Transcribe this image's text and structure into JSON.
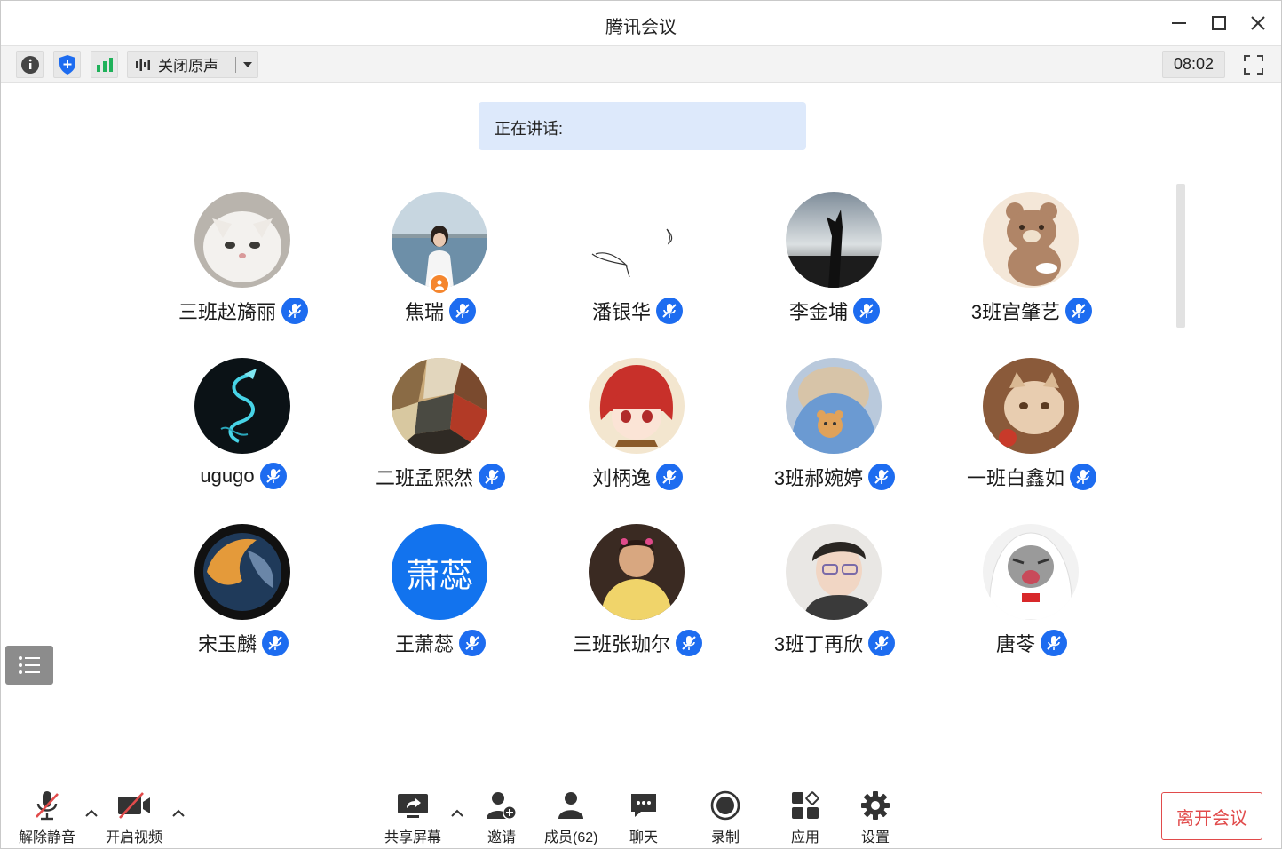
{
  "window": {
    "title": "腾讯会议"
  },
  "toolbar": {
    "info_icon": "info-icon",
    "shield_icon": "security-shield-icon",
    "signal_icon": "network-signal-icon",
    "audio_label": "关闭原声",
    "timer": "08:02"
  },
  "speaking": {
    "label": "正在讲话:"
  },
  "participants": [
    {
      "name": "三班赵旖丽",
      "avatar": "white-cat-photo"
    },
    {
      "name": "焦瑞",
      "avatar": "girl-by-sea-photo",
      "host": true
    },
    {
      "name": "潘银华",
      "avatar": "line-sketch"
    },
    {
      "name": "李金埔",
      "avatar": "sunset-hand-photo"
    },
    {
      "name": "3班宫肇艺",
      "avatar": "cartoon-bear"
    },
    {
      "name": "ugugo",
      "avatar": "neon-dragon"
    },
    {
      "name": "二班孟熙然",
      "avatar": "cubist-painting"
    },
    {
      "name": "刘柄逸",
      "avatar": "anime-red-hair"
    },
    {
      "name": "3班郝婉婷",
      "avatar": "blue-hoodie-bear"
    },
    {
      "name": "一班白鑫如",
      "avatar": "orange-cat-photo"
    },
    {
      "name": "宋玉麟",
      "avatar": "fisheye-planet"
    },
    {
      "name": "王萧蕊",
      "avatar": "text-avatar",
      "avatar_text": "萧蕊"
    },
    {
      "name": "三班张珈尔",
      "avatar": "boy-yellow-shirt"
    },
    {
      "name": "3班丁再欣",
      "avatar": "boy-glasses"
    },
    {
      "name": "唐苓",
      "avatar": "cat-in-hoodie"
    }
  ],
  "bottombar": {
    "unmute": "解除静音",
    "start_video": "开启视频",
    "share_screen": "共享屏幕",
    "invite": "邀请",
    "members": "成员(62)",
    "chat": "聊天",
    "record": "录制",
    "apps": "应用",
    "settings": "设置",
    "leave": "离开会议"
  },
  "colors": {
    "accent": "#1d6cf0",
    "leave": "#e14b4b",
    "banner": "#dde9fb"
  }
}
